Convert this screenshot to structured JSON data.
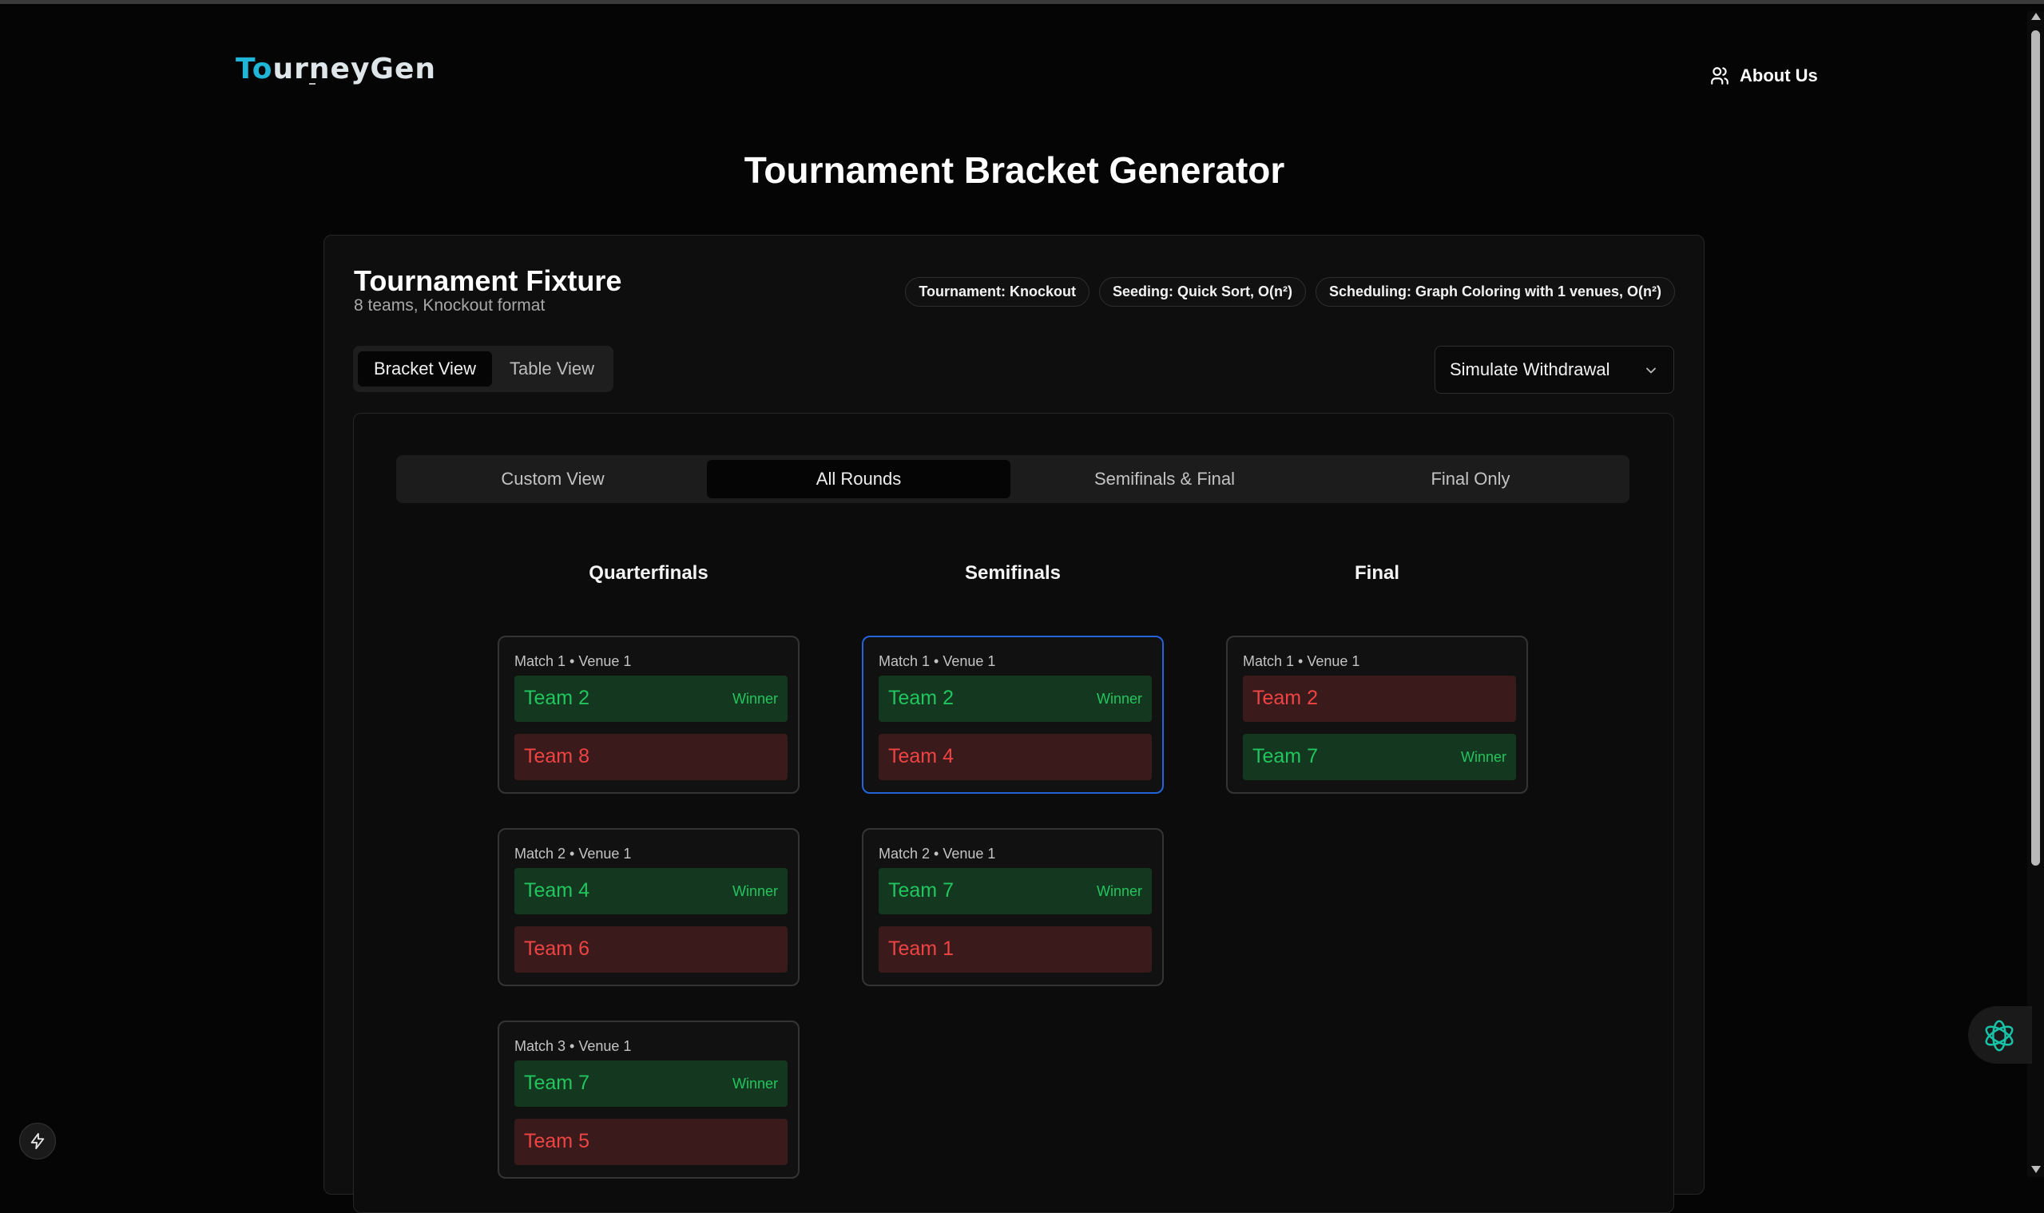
{
  "header": {
    "logo_part1": "To",
    "logo_part2": "urneyGen",
    "about_label": "About Us"
  },
  "page_title": "Tournament Bracket Generator",
  "fixture": {
    "title": "Tournament Fixture",
    "subtitle": "8 teams, Knockout format",
    "badges": [
      "Tournament: Knockout",
      "Seeding: Quick Sort, O(n²)",
      "Scheduling: Graph Coloring with 1 venues, O(n²)"
    ]
  },
  "view_toggle": {
    "bracket_label": "Bracket View",
    "table_label": "Table View",
    "active": "Bracket View"
  },
  "withdraw_select": {
    "value": "Simulate Withdrawal"
  },
  "round_tabs": {
    "custom": "Custom View",
    "all": "All Rounds",
    "semis_final": "Semifinals & Final",
    "final_only": "Final Only",
    "active": "All Rounds"
  },
  "winner_label": "Winner",
  "rounds": [
    {
      "name": "Quarterfinals",
      "matches": [
        {
          "header": "Match 1 • Venue 1",
          "team1": "Team 2",
          "team2": "Team 8",
          "winner": 1
        },
        {
          "header": "Match 2 • Venue 1",
          "team1": "Team 4",
          "team2": "Team 6",
          "winner": 1
        },
        {
          "header": "Match 3 • Venue 1",
          "team1": "Team 7",
          "team2": "Team 5",
          "winner": 1
        }
      ]
    },
    {
      "name": "Semifinals",
      "matches": [
        {
          "header": "Match 1 • Venue 1",
          "team1": "Team 2",
          "team2": "Team 4",
          "winner": 1,
          "highlighted": true
        },
        {
          "header": "Match 2 • Venue 1",
          "team1": "Team 7",
          "team2": "Team 1",
          "winner": 1
        }
      ]
    },
    {
      "name": "Final",
      "matches": [
        {
          "header": "Match 1 • Venue 1",
          "team1": "Team 2",
          "team2": "Team 7",
          "winner": 2
        }
      ]
    }
  ],
  "colors": {
    "winner_bg": "#13381f",
    "winner_text": "#22c55e",
    "loser_bg": "#3b1a1b",
    "loser_text": "#ef4444",
    "highlight_border": "#2463d9",
    "logo_accent": "#1fb6d8"
  },
  "icons": {
    "about": "users-icon",
    "select": "chevron-down-icon",
    "assistant": "openai-assistant-icon",
    "devtools": "lightning-bolt-icon"
  }
}
